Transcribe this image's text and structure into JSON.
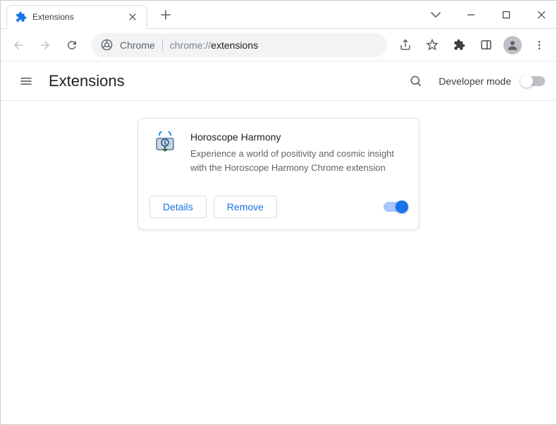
{
  "tab": {
    "title": "Extensions"
  },
  "address": {
    "chrome_label": "Chrome",
    "scheme": "chrome://",
    "path": "extensions"
  },
  "header": {
    "title": "Extensions",
    "dev_mode_label": "Developer mode",
    "dev_mode_on": false
  },
  "extension": {
    "name": "Horoscope Harmony",
    "description": "Experience a world of positivity and cosmic insight with the Horoscope Harmony Chrome extension",
    "details_label": "Details",
    "remove_label": "Remove",
    "enabled": true
  }
}
